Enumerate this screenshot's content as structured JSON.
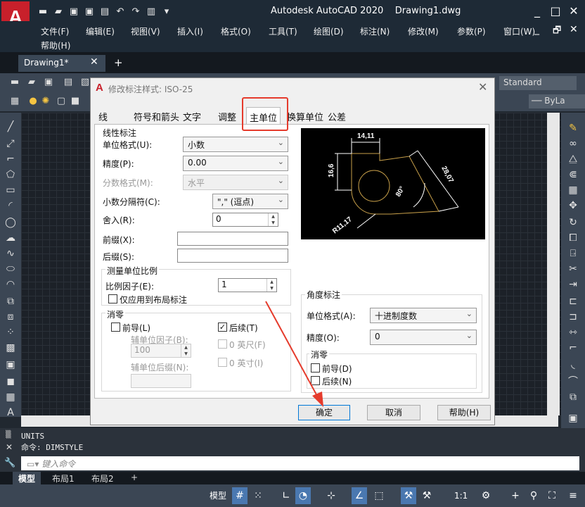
{
  "window": {
    "title": "Autodesk AutoCAD 2020    Drawing1.dwg",
    "logo_letter": "A",
    "min": "_",
    "max": "□",
    "close": "✕",
    "doc_min": "_",
    "doc_restore": "🗗",
    "doc_close": "✕"
  },
  "menu": [
    "文件(F)",
    "编辑(E)",
    "视图(V)",
    "插入(I)",
    "格式(O)",
    "工具(T)",
    "绘图(D)",
    "标注(N)",
    "修改(M)",
    "参数(P)",
    "窗口(W)",
    "帮助(H)"
  ],
  "file_tab": {
    "label": "Drawing1*",
    "close": "✕",
    "add": "+"
  },
  "ribbon": {
    "standard": "Standard",
    "bylayer": "ByLa"
  },
  "dialog": {
    "title": "修改标注样式: ISO-25",
    "tabs": [
      "线",
      "符号和箭头",
      "文字",
      "调整",
      "主单位",
      "换算单位",
      "公差"
    ],
    "linear": {
      "group": "线性标注",
      "unit_format_label": "单位格式(U):",
      "unit_format_value": "小数",
      "precision_label": "精度(P):",
      "precision_value": "0.00",
      "fraction_label": "分数格式(M):",
      "fraction_value": "水平",
      "decimal_sep_label": "小数分隔符(C):",
      "decimal_sep_value": "\",\" (逗点)",
      "round_label": "舍入(R):",
      "round_value": "0",
      "prefix_label": "前缀(X):",
      "prefix_value": "",
      "suffix_label": "后缀(S):",
      "suffix_value": ""
    },
    "scale": {
      "group": "测量单位比例",
      "factor_label": "比例因子(E):",
      "factor_value": "1",
      "layout_only": "仅应用到布局标注"
    },
    "zero": {
      "group": "消零",
      "leading": "前导(L)",
      "sub_factor_label": "辅单位因子(B):",
      "sub_factor_value": "100",
      "sub_suffix_label": "辅单位后缀(N):",
      "trailing": "后续(T)",
      "feet": "0 英尺(F)",
      "inches": "0 英寸(I)"
    },
    "angular": {
      "group": "角度标注",
      "unit_format_label": "单位格式(A):",
      "unit_format_value": "十进制度数",
      "precision_label": "精度(O):",
      "precision_value": "0",
      "zero_group": "消零",
      "leading": "前导(D)",
      "trailing": "后续(N)"
    },
    "preview": {
      "dim_top": "14,11",
      "dim_left": "16,6",
      "dim_diag": "28,07",
      "dim_angle": "80°",
      "dim_radius": "R11,17"
    },
    "buttons": {
      "ok": "确定",
      "cancel": "取消",
      "help": "帮助(H)"
    }
  },
  "command": {
    "history": [
      "UNITS",
      "命令: DIMSTYLE"
    ],
    "placeholder": "键入命令"
  },
  "layout_tabs": [
    "模型",
    "布局1",
    "布局2",
    "+"
  ],
  "status": {
    "model": "模型",
    "scale": "1:1"
  },
  "colors": {
    "highlight": "#e53b2c",
    "cad_red": "#c8202b",
    "dark": "#212830"
  }
}
